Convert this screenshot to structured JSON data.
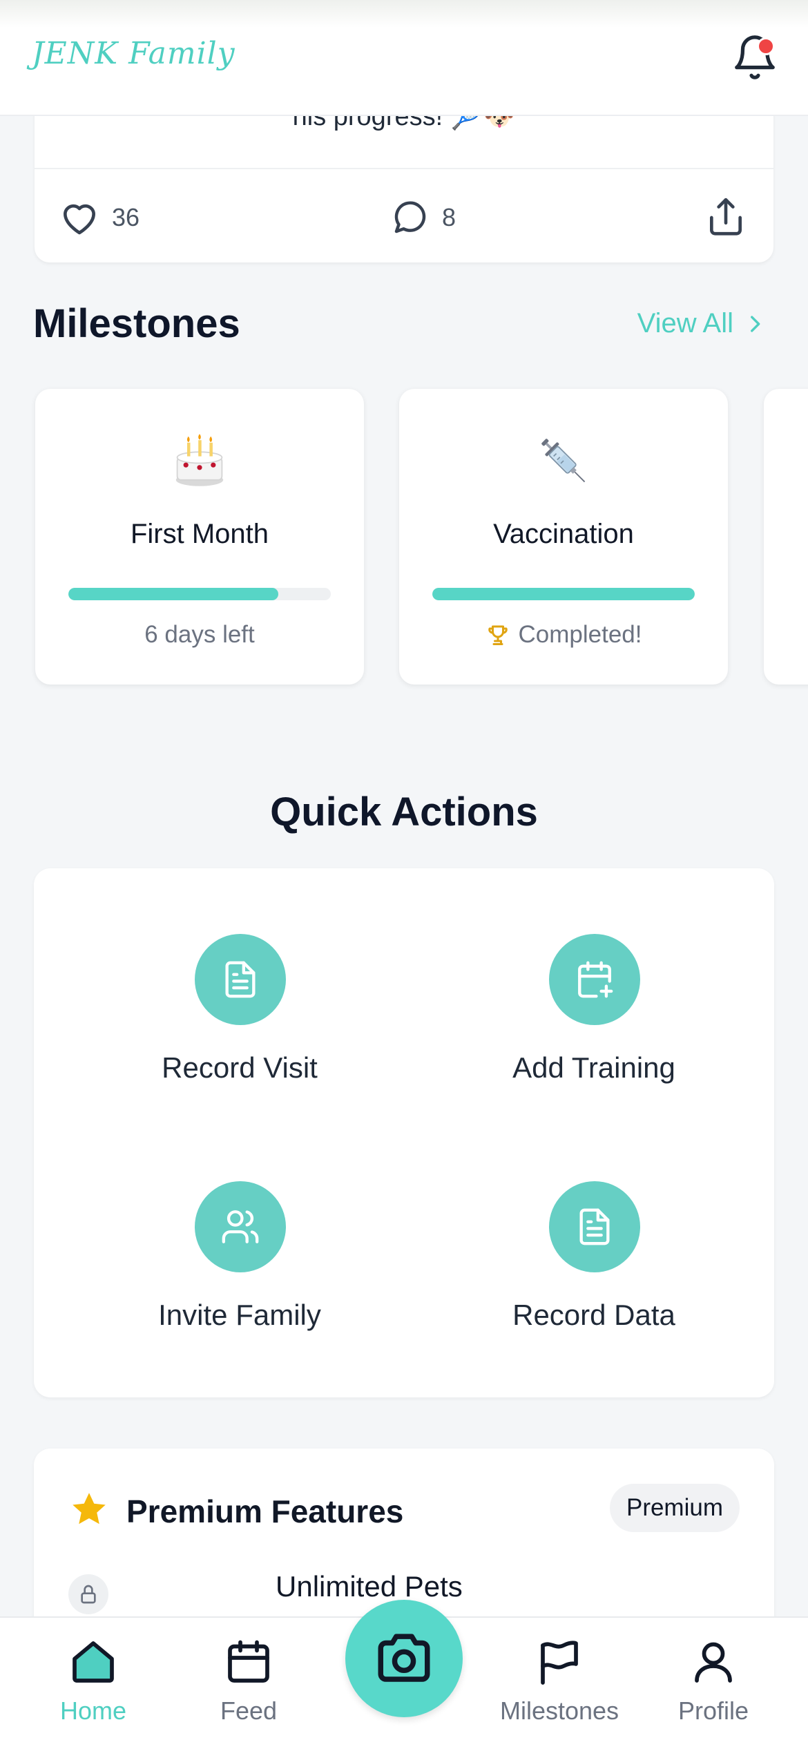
{
  "header": {
    "logo": "JENK Family",
    "has_unread_notifications": true
  },
  "post": {
    "text_partial": "his progress! 🎾🐶",
    "likes": "36",
    "comments": "8"
  },
  "milestones": {
    "title": "Milestones",
    "view_all": "View All",
    "cards": [
      {
        "emoji": "🎂",
        "title": "First Month",
        "progress": 0.8,
        "status": "6 days left"
      },
      {
        "emoji": "💉",
        "title": "Vaccination",
        "progress": 1.0,
        "status": "Completed!"
      }
    ]
  },
  "quick_actions": {
    "title": "Quick Actions",
    "items": [
      {
        "label": "Record Visit",
        "icon": "document-icon"
      },
      {
        "label": "Add Training",
        "icon": "calendar-plus-icon"
      },
      {
        "label": "Invite Family",
        "icon": "users-icon"
      },
      {
        "label": "Record Data",
        "icon": "document-icon"
      }
    ]
  },
  "premium": {
    "title": "Premium Features",
    "badge": "Premium",
    "features": [
      {
        "name": "Unlimited Pets",
        "locked": true
      }
    ]
  },
  "nav": {
    "items": [
      {
        "label": "Home",
        "active": true
      },
      {
        "label": "Feed",
        "active": false
      },
      {
        "label": "Milestones",
        "active": false
      },
      {
        "label": "Profile",
        "active": false
      }
    ]
  },
  "colors": {
    "accent": "#4fcfc1",
    "action_circle": "#66cfc4",
    "progress": "#57d5c6",
    "trophy": "#e0a412",
    "star": "#f5b80b",
    "notification_dot": "#ef4444"
  }
}
